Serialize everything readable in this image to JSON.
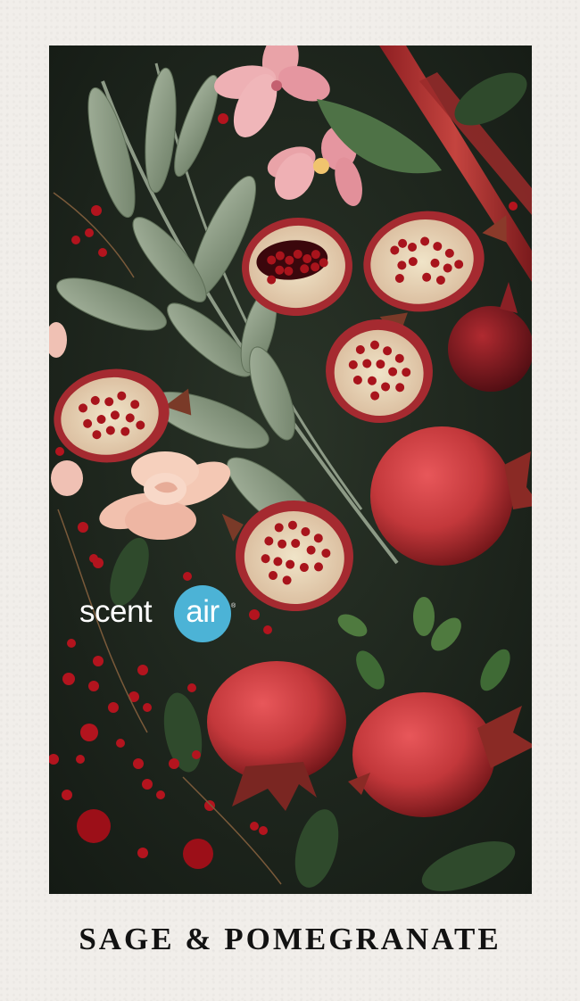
{
  "logo": {
    "word_a": "scent",
    "word_b": "air",
    "mark": "®",
    "circle_color": "#4cb3d6"
  },
  "title": "SAGE & POMEGRANATE",
  "colors": {
    "paper": "#f1eeea",
    "photo_background": "#1d261d",
    "pomegranate": "#c73a3c",
    "sage": "#8fa08a",
    "blossom": "#e9a3a8"
  }
}
